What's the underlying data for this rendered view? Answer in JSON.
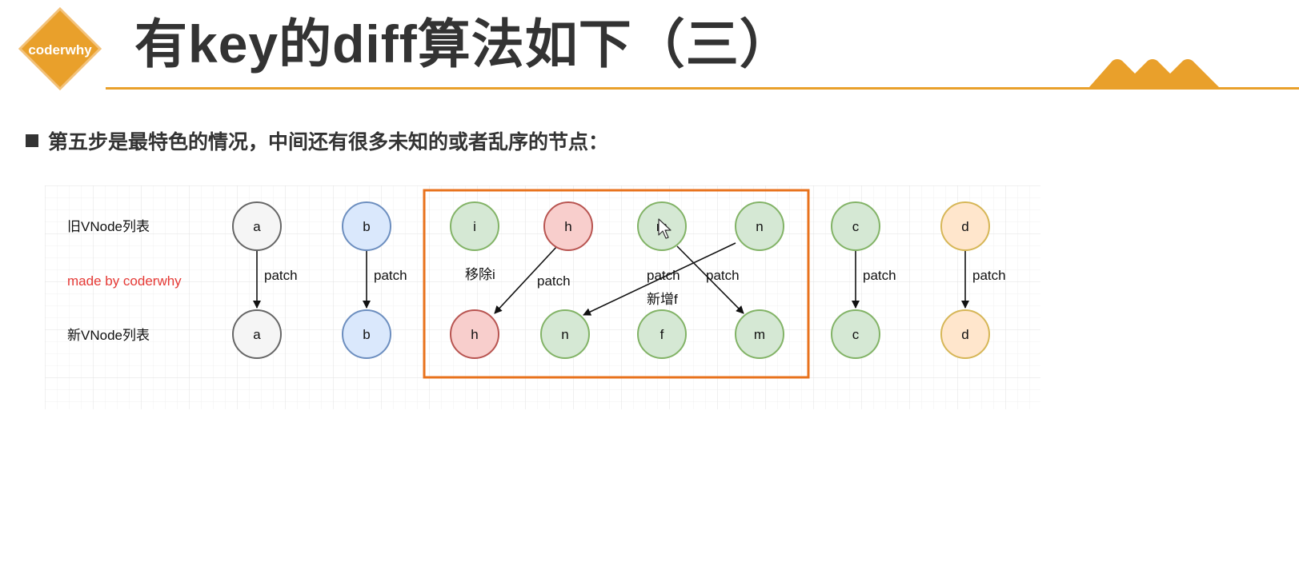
{
  "header": {
    "logo_text": "coderwhy",
    "title": "有key的diff算法如下（三）"
  },
  "bullet": {
    "text": "第五步是最特色的情况，中间还有很多未知的或者乱序的节点："
  },
  "diagram": {
    "row_labels": {
      "old": "旧VNode列表",
      "new": "新VNode列表",
      "watermark": "made by coderwhy"
    },
    "old_nodes": [
      "a",
      "b",
      "i",
      "h",
      "m",
      "n",
      "c",
      "d"
    ],
    "new_nodes": [
      "a",
      "b",
      "h",
      "n",
      "f",
      "m",
      "c",
      "d"
    ],
    "annotations": {
      "patch_a": "patch",
      "patch_b": "patch",
      "remove_i": "移除i",
      "patch_h": "patch",
      "patch_m": "patch",
      "patch_n": "patch",
      "add_f": "新增f",
      "patch_c": "patch",
      "patch_d": "patch"
    },
    "colors": {
      "grey_fill": "#f5f5f5",
      "grey_stroke": "#666666",
      "blue_fill": "#dae8fc",
      "blue_stroke": "#6c8ebf",
      "green_fill": "#d5e8d4",
      "green_stroke": "#82b366",
      "red_fill": "#f8cecc",
      "red_stroke": "#b85450",
      "orange_fill": "#ffe6cc",
      "orange_stroke": "#d6b656",
      "highlight_box": "#e8721c",
      "watermark": "#e53935",
      "accent": "#e9a02b"
    }
  }
}
